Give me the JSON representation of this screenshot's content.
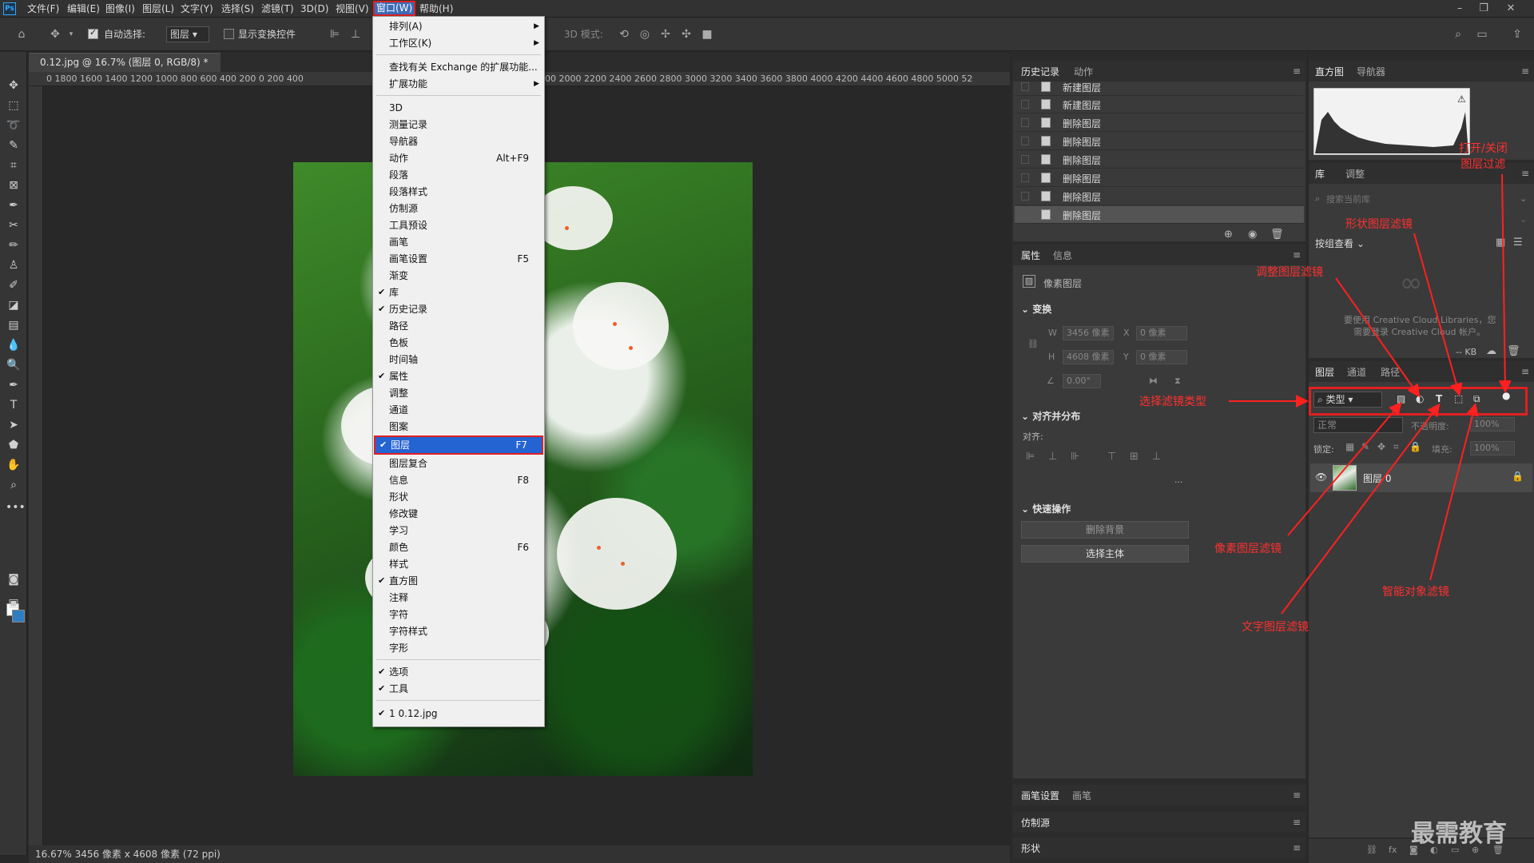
{
  "menubar": {
    "logo": "Ps",
    "items": [
      "文件(F)",
      "编辑(E)",
      "图像(I)",
      "图层(L)",
      "文字(Y)",
      "选择(S)",
      "滤镜(T)",
      "3D(D)",
      "视图(V)",
      "窗口(W)",
      "帮助(H)"
    ]
  },
  "options": {
    "auto_select_label": "自动选择:",
    "auto_select_target": "图层",
    "show_transform_label": "显示变换控件",
    "mode_3d_label": "3D 模式:"
  },
  "document": {
    "tab_title": "0.12.jpg @ 16.7% (图层 0, RGB/8) *",
    "tab_close": "×",
    "ruler_top": "0 1800 1600 1400 1200 1000 800 600 400 200 0 200 400",
    "ruler_top_right": "00 2000 2200 2400 2600 2800 3000 3200 3400 3600 3800 4000 4200 4400 4600 4800 5000 52",
    "status": "16.67%  3456 像素 x 4608 像素 (72 ppi)"
  },
  "window_menu": {
    "items": [
      {
        "label": "排列(A)",
        "arrow": true
      },
      {
        "label": "工作区(K)",
        "arrow": true
      },
      {
        "label": "查找有关 Exchange 的扩展功能..."
      },
      {
        "label": "扩展功能",
        "arrow": true
      },
      {
        "label": "3D"
      },
      {
        "label": "测量记录"
      },
      {
        "label": "导航器"
      },
      {
        "label": "动作",
        "shortcut": "Alt+F9"
      },
      {
        "label": "段落"
      },
      {
        "label": "段落样式"
      },
      {
        "label": "仿制源"
      },
      {
        "label": "工具预设"
      },
      {
        "label": "画笔"
      },
      {
        "label": "画笔设置",
        "shortcut": "F5"
      },
      {
        "label": "渐变"
      },
      {
        "label": "库",
        "checked": true
      },
      {
        "label": "历史记录",
        "checked": true
      },
      {
        "label": "路径"
      },
      {
        "label": "色板"
      },
      {
        "label": "时间轴"
      },
      {
        "label": "属性",
        "checked": true
      },
      {
        "label": "调整"
      },
      {
        "label": "通道"
      },
      {
        "label": "图案"
      },
      {
        "label": "图层",
        "shortcut": "F7",
        "checked": true
      },
      {
        "label": "图层复合"
      },
      {
        "label": "信息",
        "shortcut": "F8"
      },
      {
        "label": "形状"
      },
      {
        "label": "修改键"
      },
      {
        "label": "学习"
      },
      {
        "label": "颜色",
        "shortcut": "F6"
      },
      {
        "label": "样式"
      },
      {
        "label": "直方图",
        "checked": true
      },
      {
        "label": "注释"
      },
      {
        "label": "字符"
      },
      {
        "label": "字符样式"
      },
      {
        "label": "字形"
      },
      {
        "label": "选项",
        "checked": true
      },
      {
        "label": "工具",
        "checked": true
      },
      {
        "label": "1 0.12.jpg",
        "checked": true
      }
    ]
  },
  "history_panel": {
    "tabs": [
      "历史记录",
      "动作"
    ],
    "rows": [
      "新建图层",
      "新建图层",
      "删除图层",
      "删除图层",
      "删除图层",
      "删除图层",
      "删除图层",
      "删除图层"
    ]
  },
  "properties_panel": {
    "tabs": [
      "属性",
      "信息"
    ],
    "layer_type": "像素图层",
    "transform_title": "变换",
    "w_label": "W",
    "w_value": "3456 像素",
    "x_label": "X",
    "x_value": "0 像素",
    "h_label": "H",
    "h_value": "4608 像素",
    "y_label": "Y",
    "y_value": "0 像素",
    "angle_value": "0.00°",
    "align_title": "对齐并分布",
    "align_label": "对齐:",
    "more": "...",
    "quick_title": "快速操作",
    "remove_bg": "删除背景",
    "select_subject": "选择主体"
  },
  "bottom_left_panels": [
    "画笔设置",
    "画笔",
    "仿制源",
    "形状"
  ],
  "histogram_panel": {
    "tabs": [
      "直方图",
      "导航器"
    ]
  },
  "library_panel": {
    "tabs": [
      "库",
      "调整"
    ],
    "search_placeholder": "搜索当前库",
    "view_label": "按组查看",
    "msg_line1": "要使用 Creative Cloud Libraries，您",
    "msg_line2": "需要登录 Creative Cloud 帐户。",
    "size": "-- KB"
  },
  "layers_panel": {
    "tabs": [
      "图层",
      "通道",
      "路径"
    ],
    "filter_type": "类型",
    "blend_mode": "正常",
    "opacity_label": "不透明度:",
    "opacity_value": "100%",
    "lock_label": "锁定:",
    "fill_label": "填充:",
    "fill_value": "100%",
    "layer_name": "图层 0"
  },
  "annotations": {
    "toggle_filter": "打开/关闭\n图层过滤",
    "shape_filter": "形状图层滤镜",
    "adjust_filter": "调整图层滤镜",
    "select_type": "选择滤镜类型",
    "pixel_filter": "像素图层滤镜",
    "smart_filter": "智能对象滤镜",
    "text_filter": "文字图层滤镜"
  },
  "watermark": "最需教育",
  "colors": {
    "annotation": "#ff3030",
    "highlight": "#2463d2",
    "foreground": "#ffffff",
    "background": "#2f7ec0"
  }
}
